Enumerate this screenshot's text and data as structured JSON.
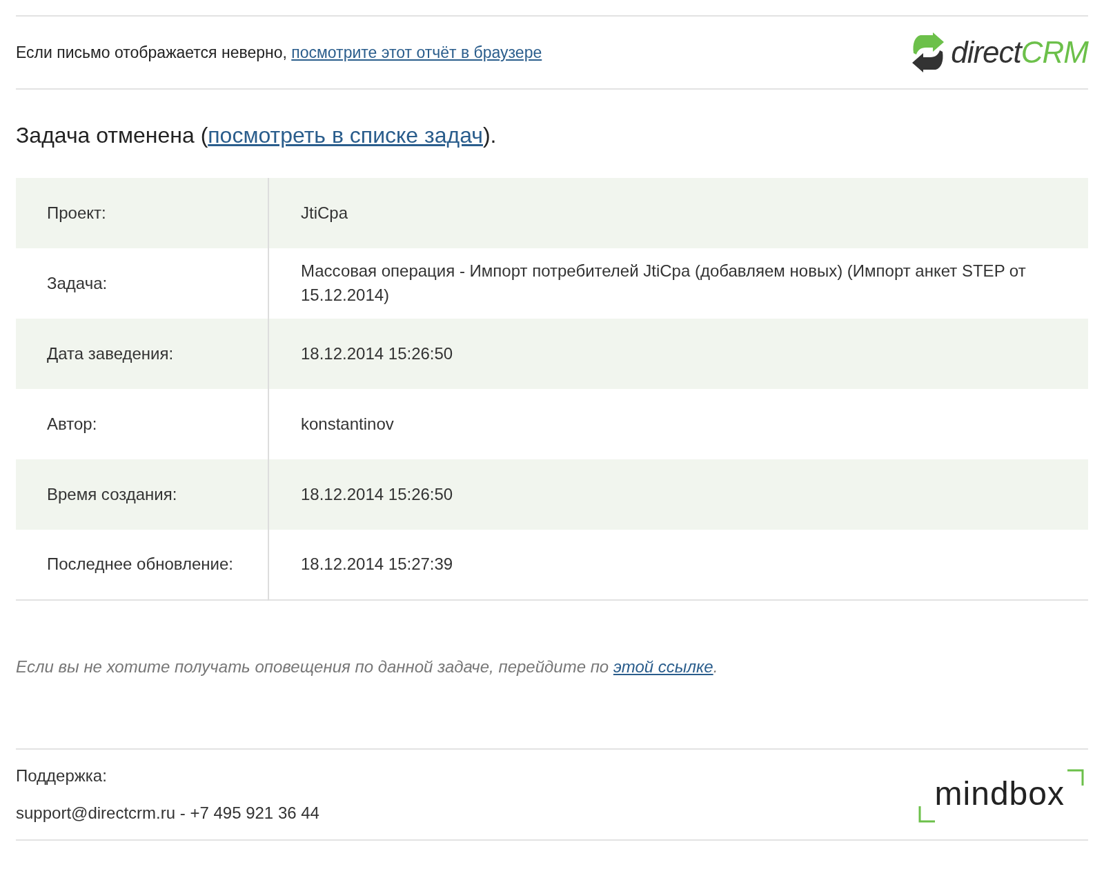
{
  "header": {
    "notice_text": "Если письмо отображается неверно,",
    "notice_link": "посмотрите этот отчёт в браузере",
    "logo": {
      "prefix": "direct",
      "suffix": "CRM"
    }
  },
  "title": {
    "before": "Задача отменена (",
    "link": "посмотреть в списке задач",
    "after": ")."
  },
  "rows": [
    {
      "label": "Проект:",
      "value": "JtiCpa"
    },
    {
      "label": "Задача:",
      "value": "Массовая операция - Импорт потребителей JtiCpa (добавляем новых) (Импорт анкет STEP от 15.12.2014)"
    },
    {
      "label": "Дата заведения:",
      "value": "18.12.2014 15:26:50"
    },
    {
      "label": "Автор:",
      "value": "konstantinov"
    },
    {
      "label": "Время создания:",
      "value": "18.12.2014 15:26:50"
    },
    {
      "label": "Последнее обновление:",
      "value": "18.12.2014 15:27:39"
    }
  ],
  "unsubscribe": {
    "text": "Если вы не хотите получать оповещения по данной задаче, перейдите по",
    "link": "этой ссылке",
    "after": "."
  },
  "footer": {
    "label": "Поддержка:",
    "contact": "support@directcrm.ru - +7 495 921 36 44",
    "logo": "mindbox"
  }
}
